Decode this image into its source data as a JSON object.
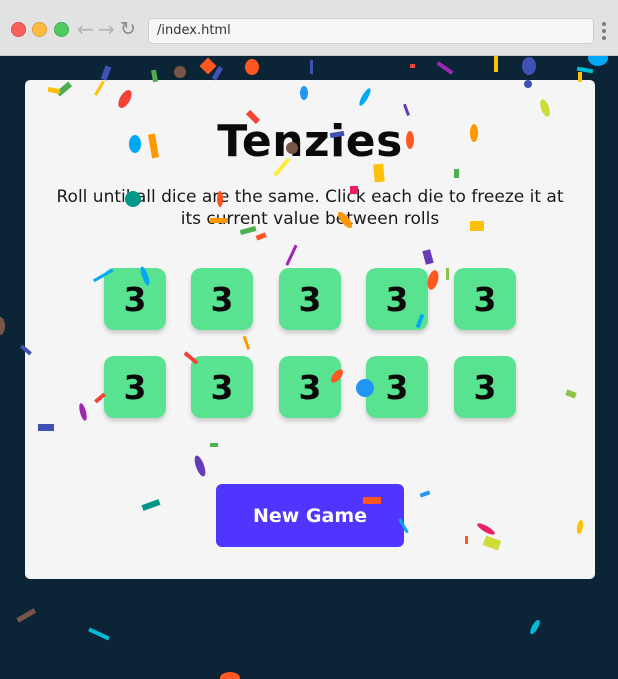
{
  "browser": {
    "url": "/index.html"
  },
  "game": {
    "title": "Tenzies",
    "instructions": "Roll until all dice are the same. Click each die to freeze it at its current value between rolls",
    "dice": [
      "3",
      "3",
      "3",
      "3",
      "3",
      "3",
      "3",
      "3",
      "3",
      "3"
    ],
    "new_game_label": "New Game"
  },
  "colors": {
    "background": "#0b2436",
    "card": "#f5f5f6",
    "die_held": "#59e391",
    "button": "#5035ff"
  },
  "icons": {
    "back": "arrow-left-icon",
    "forward": "arrow-right-icon",
    "reload": "reload-icon",
    "menu": "vertical-dots-icon"
  }
}
